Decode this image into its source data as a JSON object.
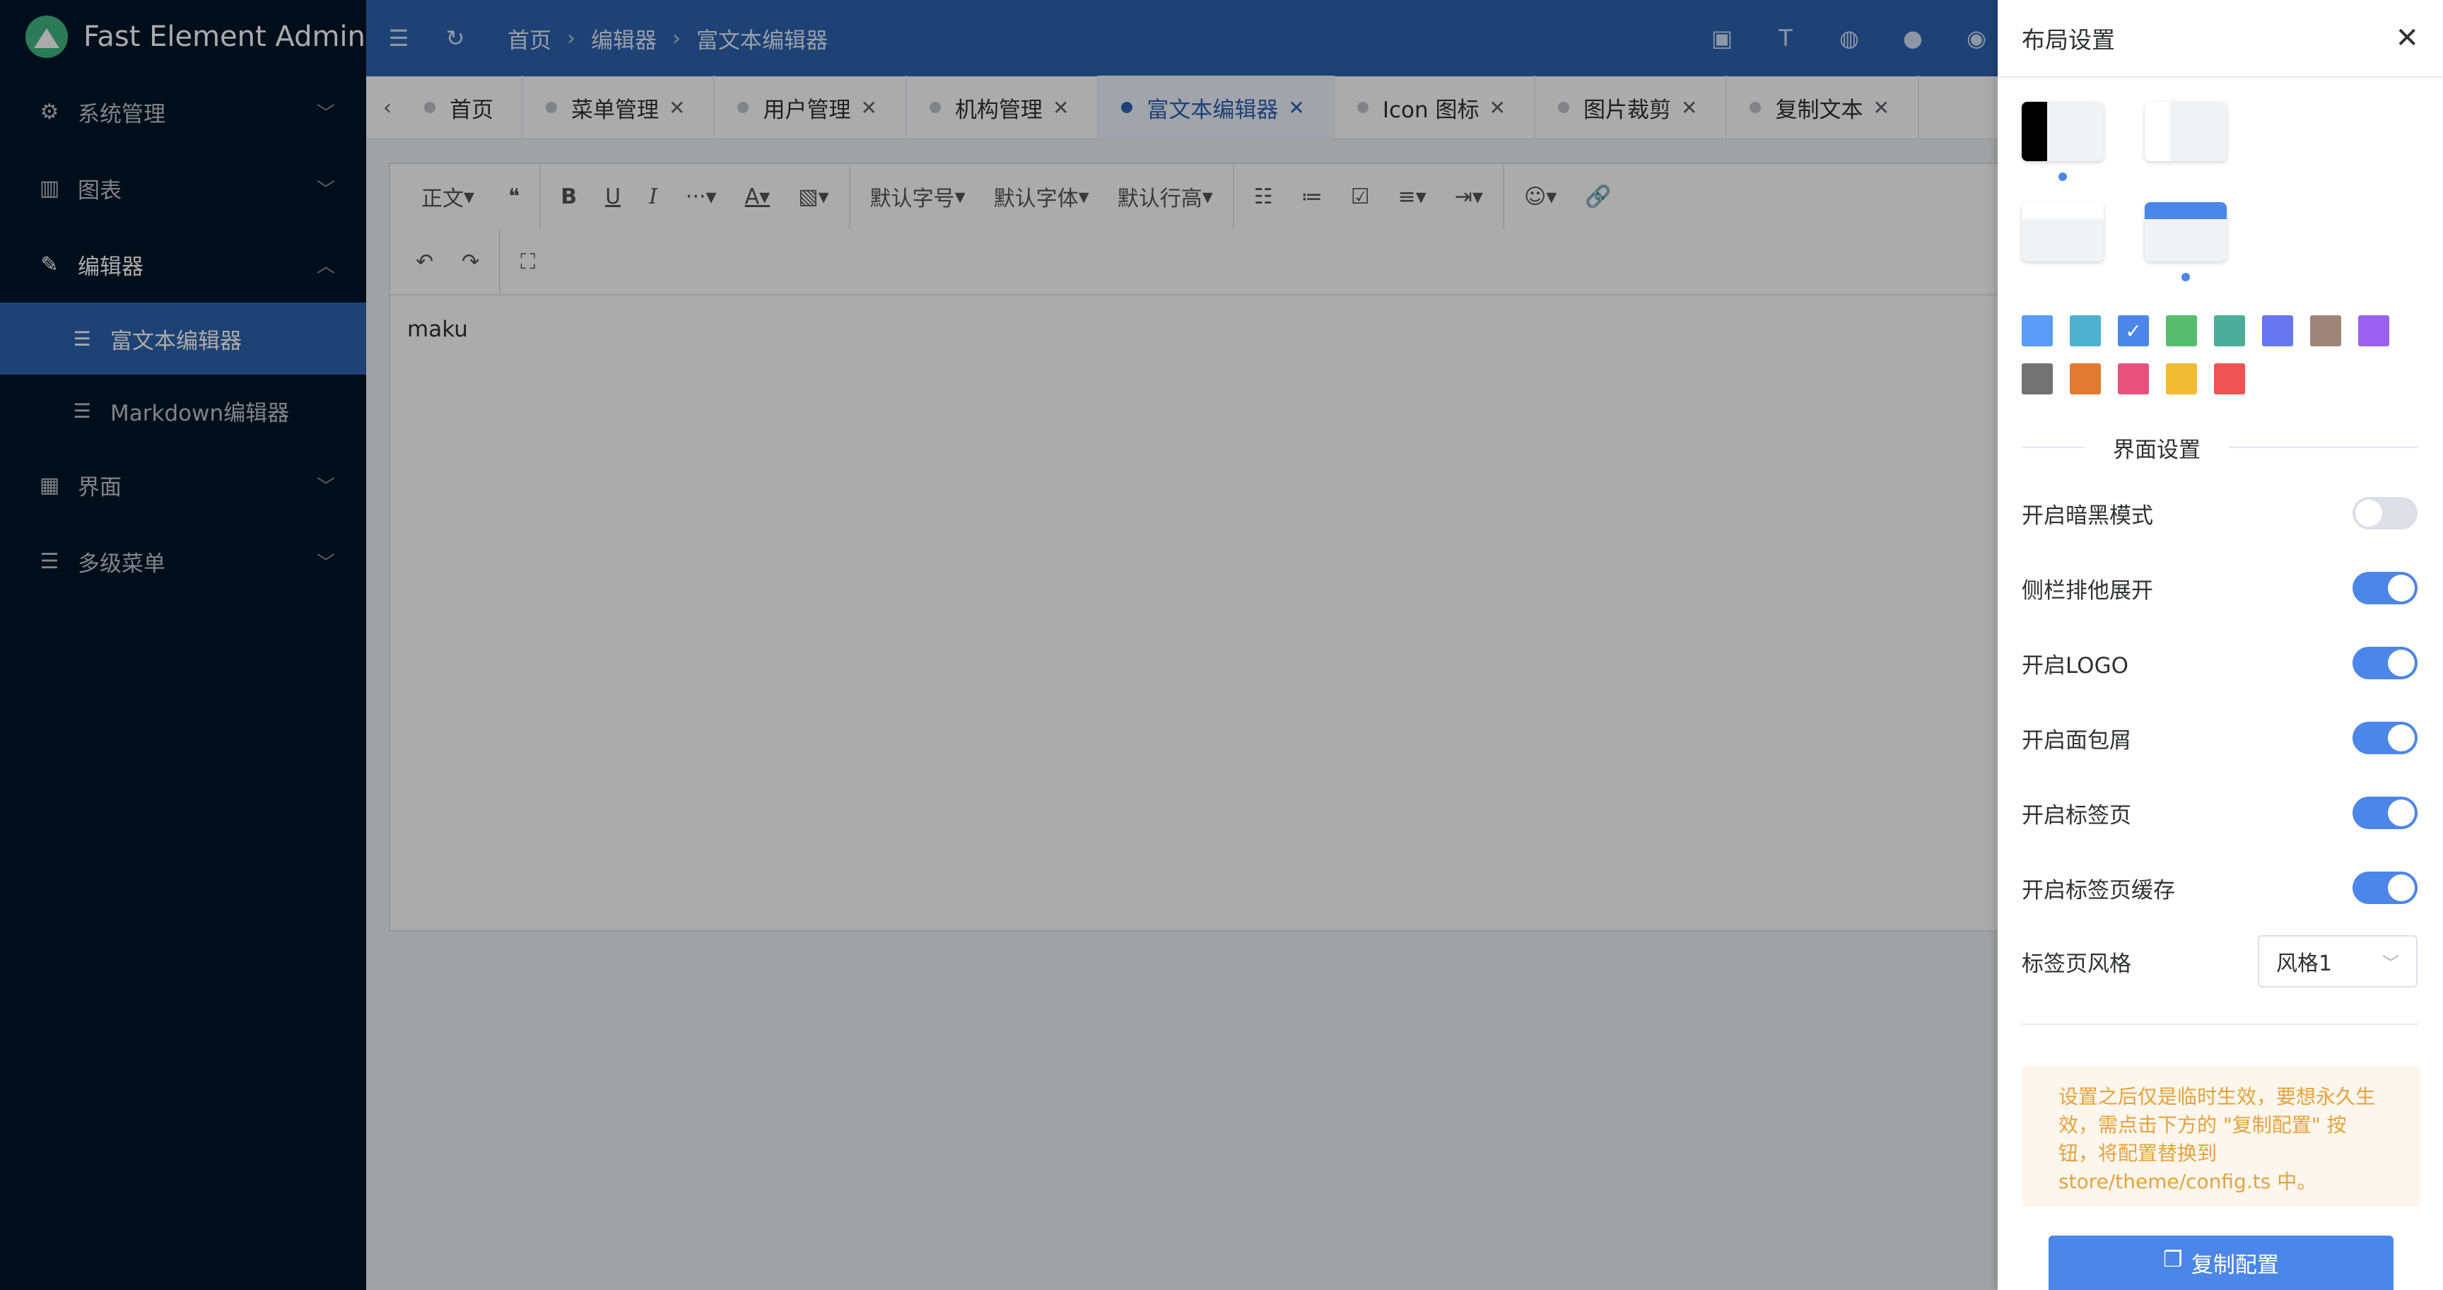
{
  "app": {
    "title": "Fast Element Admin",
    "logo_color": "#41b883"
  },
  "sidebar": {
    "items": [
      {
        "label": "系统管理",
        "icon": "gear-icon"
      },
      {
        "label": "图表",
        "icon": "chart-icon"
      },
      {
        "label": "编辑器",
        "icon": "pen-icon"
      },
      {
        "label": "界面",
        "icon": "layout-icon"
      },
      {
        "label": "多级菜单",
        "icon": "list-icon"
      }
    ],
    "sub_items": [
      {
        "label": "富文本编辑器",
        "active": true
      },
      {
        "label": "Markdown编辑器",
        "active": false
      }
    ]
  },
  "header": {
    "breadcrumb": [
      "首页",
      "编辑器",
      "富文本编辑器"
    ]
  },
  "tabs": [
    {
      "label": "首页",
      "closable": false
    },
    {
      "label": "菜单管理",
      "closable": true
    },
    {
      "label": "用户管理",
      "closable": true
    },
    {
      "label": "机构管理",
      "closable": true
    },
    {
      "label": "富文本编辑器",
      "closable": true,
      "active": true
    },
    {
      "label": "Icon 图标",
      "closable": true
    },
    {
      "label": "图片裁剪",
      "closable": true
    },
    {
      "label": "复制文本",
      "closable": true
    }
  ],
  "editor": {
    "toolbar": {
      "paragraph": "正文",
      "font_size": "默认字号",
      "font_family": "默认字体",
      "line_height": "默认行高"
    },
    "content": "maku"
  },
  "drawer": {
    "title": "布局设置",
    "colors": [
      "#5a9cf8",
      "#4fb1cf",
      "#4c86e8",
      "#58bb6d",
      "#4aae9a",
      "#6677ef",
      "#9e8479",
      "#9961ee",
      "#727272",
      "#e07a30",
      "#e9517d",
      "#f1bb33",
      "#ee5353"
    ],
    "selected_color": "#4c86e8",
    "section_title": "界面设置",
    "settings": [
      {
        "label": "开启暗黑模式",
        "on": false
      },
      {
        "label": "侧栏排他展开",
        "on": true
      },
      {
        "label": "开启LOGO",
        "on": true
      },
      {
        "label": "开启面包屑",
        "on": true
      },
      {
        "label": "开启标签页",
        "on": true
      },
      {
        "label": "开启标签页缓存",
        "on": true
      }
    ],
    "tab_style_label": "标签页风格",
    "tab_style_value": "风格1",
    "tip": "设置之后仅是临时生效，要想永久生效，需点击下方的 \"复制配置\" 按钮，将配置替换到 store/theme/config.ts 中。",
    "copy_button": "复制配置"
  }
}
